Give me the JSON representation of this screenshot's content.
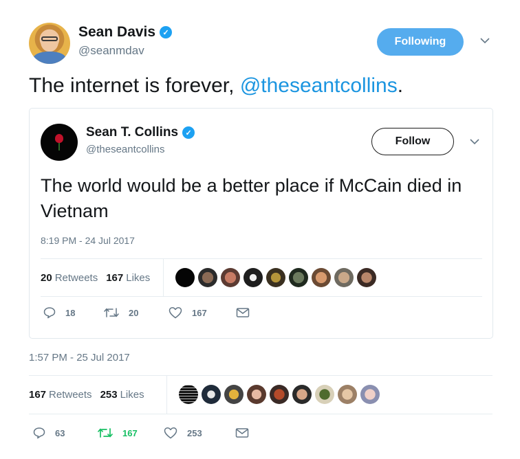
{
  "tweet": {
    "author_name": "Sean Davis",
    "author_handle": "@seanmdav",
    "follow_state": "Following",
    "text_prefix": "The internet is forever, ",
    "text_mention": "@theseantcollins",
    "text_suffix": ".",
    "timestamp": "1:57 PM - 25 Jul 2017",
    "retweets_count": "167",
    "retweets_label": "Retweets",
    "likes_count": "253",
    "likes_label": "Likes",
    "actions": {
      "replies": "63",
      "retweets": "167",
      "likes": "253"
    },
    "colors": {
      "accent": "#1da1f2",
      "retweet_active": "#17bf63",
      "mention": "#1b95e0"
    }
  },
  "quoted": {
    "author_name": "Sean T. Collins",
    "author_handle": "@theseantcollins",
    "follow_label": "Follow",
    "text": "The world would be a better place if McCain died in Vietnam",
    "timestamp": "8:19 PM - 24 Jul 2017",
    "retweets_count": "20",
    "retweets_label": "Retweets",
    "likes_count": "167",
    "likes_label": "Likes",
    "actions": {
      "replies": "18",
      "retweets": "20",
      "likes": "167"
    }
  },
  "icons": {
    "reply": "reply-icon",
    "retweet": "retweet-icon",
    "like": "heart-icon",
    "message": "envelope-icon",
    "menu": "chevron-down-icon",
    "verified": "verified-badge-icon"
  }
}
